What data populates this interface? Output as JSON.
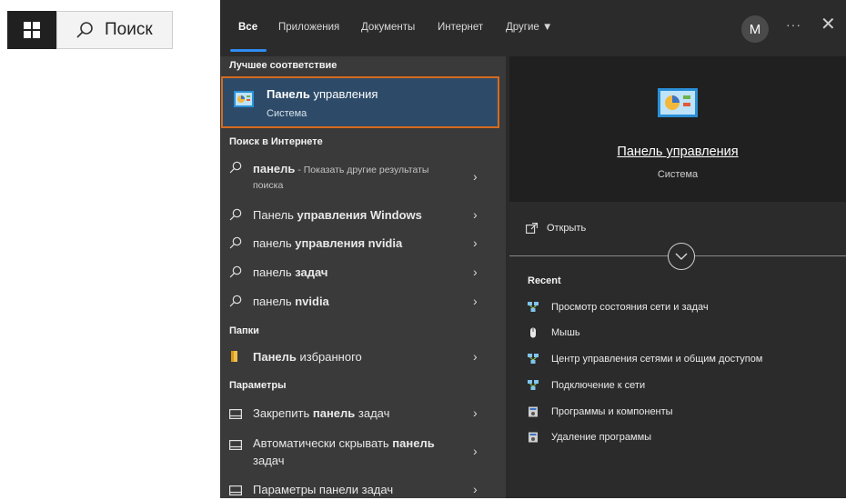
{
  "taskbar": {
    "search_placeholder": "Поиск"
  },
  "tabs": {
    "all": "Все",
    "apps": "Приложения",
    "documents": "Документы",
    "internet": "Интернет",
    "other": "Другие"
  },
  "profile": {
    "initial": "M"
  },
  "more_glyph": "···",
  "close_glyph": "✕",
  "left": {
    "best_match_title": "Лучшее соответствие",
    "best_match": {
      "name_bold": "Панель",
      "name_rest": " управления",
      "subtitle": "Система"
    },
    "web_title": "Поиск в Интернете",
    "web_results": [
      {
        "bold": "панель",
        "rest": "",
        "sub": " - Показать другие результаты",
        "sub2": "поиска"
      },
      {
        "pre": "Панель ",
        "bold": "управления Windows"
      },
      {
        "pre": "панель ",
        "bold": "управления nvidia"
      },
      {
        "pre": "панель ",
        "bold": "задач"
      },
      {
        "pre": "панель ",
        "bold": "nvidia"
      }
    ],
    "folders_title": "Папки",
    "folder": {
      "bold": "Панель",
      "rest": " избранного"
    },
    "settings_title": "Параметры",
    "settings": [
      {
        "pre": "Закрепить ",
        "bold": "панель",
        "rest": " задач"
      },
      {
        "pre": "Автоматически скрывать ",
        "bold": "панель",
        "line2": "задач"
      },
      {
        "pre": "Параметры панели задач"
      }
    ]
  },
  "right": {
    "title": "Панель управления",
    "subtitle": "Система",
    "open_label": "Открыть",
    "recent_title": "Recent",
    "recent": [
      {
        "label": "Просмотр состояния сети и задач",
        "icon": "network-icon"
      },
      {
        "label": "Мышь",
        "icon": "mouse-icon"
      },
      {
        "label": "Центр управления сетями и общим доступом",
        "icon": "network-icon"
      },
      {
        "label": "Подключение к сети",
        "icon": "network-icon"
      },
      {
        "label": "Программы и компоненты",
        "icon": "programs-icon"
      },
      {
        "label": "Удаление программы",
        "icon": "programs-icon"
      }
    ]
  },
  "colors": {
    "accent_blue": "#2f8cf0",
    "selection_bg": "#2d4b69",
    "selection_border": "#d66a1f"
  }
}
